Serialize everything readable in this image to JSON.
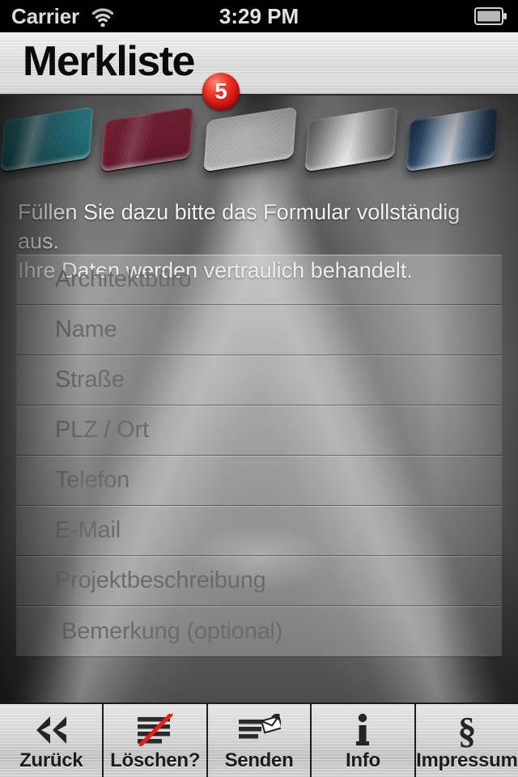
{
  "status_bar": {
    "carrier": "Carrier",
    "wifi_icon": "wifi-icon",
    "time": "3:29 PM",
    "battery_icon": "battery-full-icon"
  },
  "nav_bar": {
    "title": "Merkliste",
    "badge_count": "5",
    "badge_color": "#d41a16"
  },
  "tiles": [
    {
      "name": "tile-teal",
      "color": "#25838f"
    },
    {
      "name": "tile-red",
      "color": "#7d1630"
    },
    {
      "name": "tile-silver-matte",
      "color": "#cfcfcf"
    },
    {
      "name": "tile-silver-polished",
      "color": "#b6b6b6"
    },
    {
      "name": "tile-blue",
      "color": "#27486c"
    }
  ],
  "intro": {
    "line1": "Füllen Sie dazu bitte das Formular vollständig aus.",
    "line2": "Ihre Daten werden vertraulich behandelt."
  },
  "form": {
    "fields": [
      {
        "name": "field-architekturbuero",
        "placeholder": "Architektbüro"
      },
      {
        "name": "field-name",
        "placeholder": "Name"
      },
      {
        "name": "field-strasse",
        "placeholder": "Straße"
      },
      {
        "name": "field-plz-ort",
        "placeholder": "PLZ / Ort"
      },
      {
        "name": "field-telefon",
        "placeholder": "Telefon"
      },
      {
        "name": "field-email",
        "placeholder": "E-Mail"
      },
      {
        "name": "field-projektbeschreibung",
        "placeholder": "Projektbeschreibung"
      },
      {
        "name": "field-bemerkung",
        "placeholder": "Bemerkung (optional)"
      }
    ]
  },
  "toolbar": {
    "buttons": [
      {
        "name": "back-button",
        "label": "Zurück",
        "icon": "double-chevron-left-icon"
      },
      {
        "name": "delete-button",
        "label": "Löschen?",
        "icon": "lines-with-red-slash-icon"
      },
      {
        "name": "send-button",
        "label": "Senden",
        "icon": "lines-with-envelope-icon"
      },
      {
        "name": "info-button",
        "label": "Info",
        "icon": "info-i-icon"
      },
      {
        "name": "imprint-button",
        "label": "Impressum",
        "icon": "paragraph-section-icon"
      }
    ]
  }
}
